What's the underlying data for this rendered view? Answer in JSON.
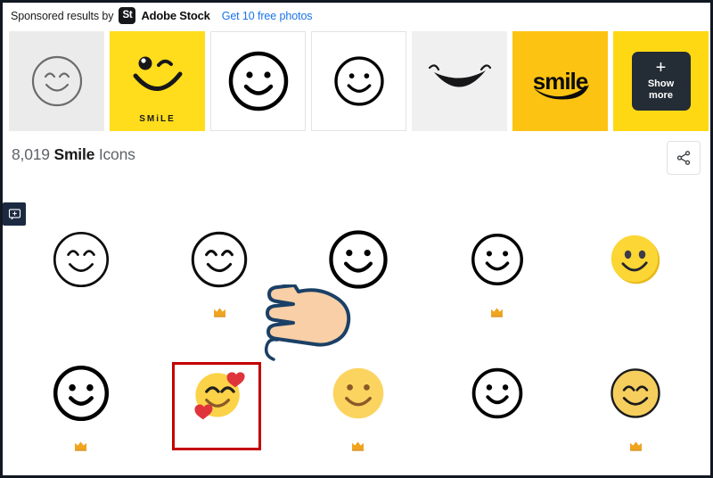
{
  "header": {
    "sponsored_label": "Sponsored results by",
    "badge_text": "St",
    "brand": "Adobe Stock",
    "offer_link": "Get 10 free photos"
  },
  "thumbnails": [
    {
      "name": "thumb-smiley-gray",
      "caption": "",
      "bg": "#ebebeb",
      "art": "outline-smiley-curved-eyes",
      "art_color": "#5a5a5a"
    },
    {
      "name": "thumb-winking-smile-yellow",
      "caption": "SMiLE",
      "bg": "#ffdd1c",
      "art": "winking-smiley",
      "art_color": "#1a1a1a"
    },
    {
      "name": "thumb-bold-smiley-white-1",
      "caption": "",
      "bg": "#ffffff",
      "art": "outline-smiley-dot-eyes",
      "art_color": "#000000"
    },
    {
      "name": "thumb-bold-smiley-white-2",
      "caption": "",
      "bg": "#ffffff",
      "art": "outline-smiley-dot-eyes",
      "art_color": "#000000"
    },
    {
      "name": "thumb-smile-curve-gray",
      "caption": "",
      "bg": "#f0f0f0",
      "art": "smile-curve-only",
      "art_color": "#111111"
    },
    {
      "name": "thumb-smile-wordmark-yellow",
      "caption": "smile",
      "bg": "#fcc313",
      "art": "smile-wordmark",
      "art_color": "#000000"
    },
    {
      "name": "thumb-show-more",
      "caption": "",
      "bg": "#ffd814",
      "art": "show-more-card",
      "art_color": "#ffffff"
    }
  ],
  "show_more": {
    "plus_glyph": "+",
    "line1": "Show",
    "line2": "more"
  },
  "results": {
    "count": "8,019",
    "keyword": "Smile",
    "suffix": "Icons",
    "share_icon": "share-icon"
  },
  "feedback": {
    "icon": "feedback-bubble-icon"
  },
  "colors": {
    "link_blue": "#1a73e8",
    "brand_yellow": "#ffdd1c",
    "amber": "#fcc313",
    "selection_red": "#c40000",
    "crown_gold": "#f0a41e",
    "dark_navy": "#1b2a41",
    "emoji_yellow": "#fcd54f",
    "heart_red": "#e0343c"
  },
  "grid": {
    "rows": [
      {
        "cells": [
          {
            "name": "icon-outline-smiley-curved-eyes-1",
            "art": "outline-smiley-curved-eyes",
            "premium": false,
            "selected": false
          },
          {
            "name": "icon-outline-smiley-curved-eyes-2",
            "art": "outline-smiley-curved-eyes",
            "premium": true,
            "selected": false
          },
          {
            "name": "icon-bold-smiley-dot-eyes-1",
            "art": "bold-smiley-dot-eyes",
            "premium": false,
            "selected": false
          },
          {
            "name": "icon-bold-smiley-dot-eyes-2",
            "art": "bold-smiley-dot-eyes",
            "premium": true,
            "selected": false
          },
          {
            "name": "icon-filled-yellow-smiley-1",
            "art": "filled-yellow-smiley",
            "premium": false,
            "selected": false
          }
        ]
      },
      {
        "cells": [
          {
            "name": "icon-bold-smiley-dot-eyes-3",
            "art": "bold-smiley-dot-eyes",
            "premium": true,
            "selected": false
          },
          {
            "name": "icon-smiling-face-with-hearts",
            "art": "smiling-face-with-hearts",
            "premium": false,
            "selected": true
          },
          {
            "name": "icon-filled-yellow-smiley-brown",
            "art": "filled-yellow-smiley-brown",
            "premium": true,
            "selected": false
          },
          {
            "name": "icon-bold-smiley-dot-eyes-4",
            "art": "bold-smiley-dot-eyes",
            "premium": false,
            "selected": false
          },
          {
            "name": "icon-filled-smiley-curved-eyes",
            "art": "filled-smiley-curved-eyes",
            "premium": true,
            "selected": false
          }
        ]
      }
    ]
  },
  "cursor": {
    "name": "pointing-hand-cursor"
  }
}
